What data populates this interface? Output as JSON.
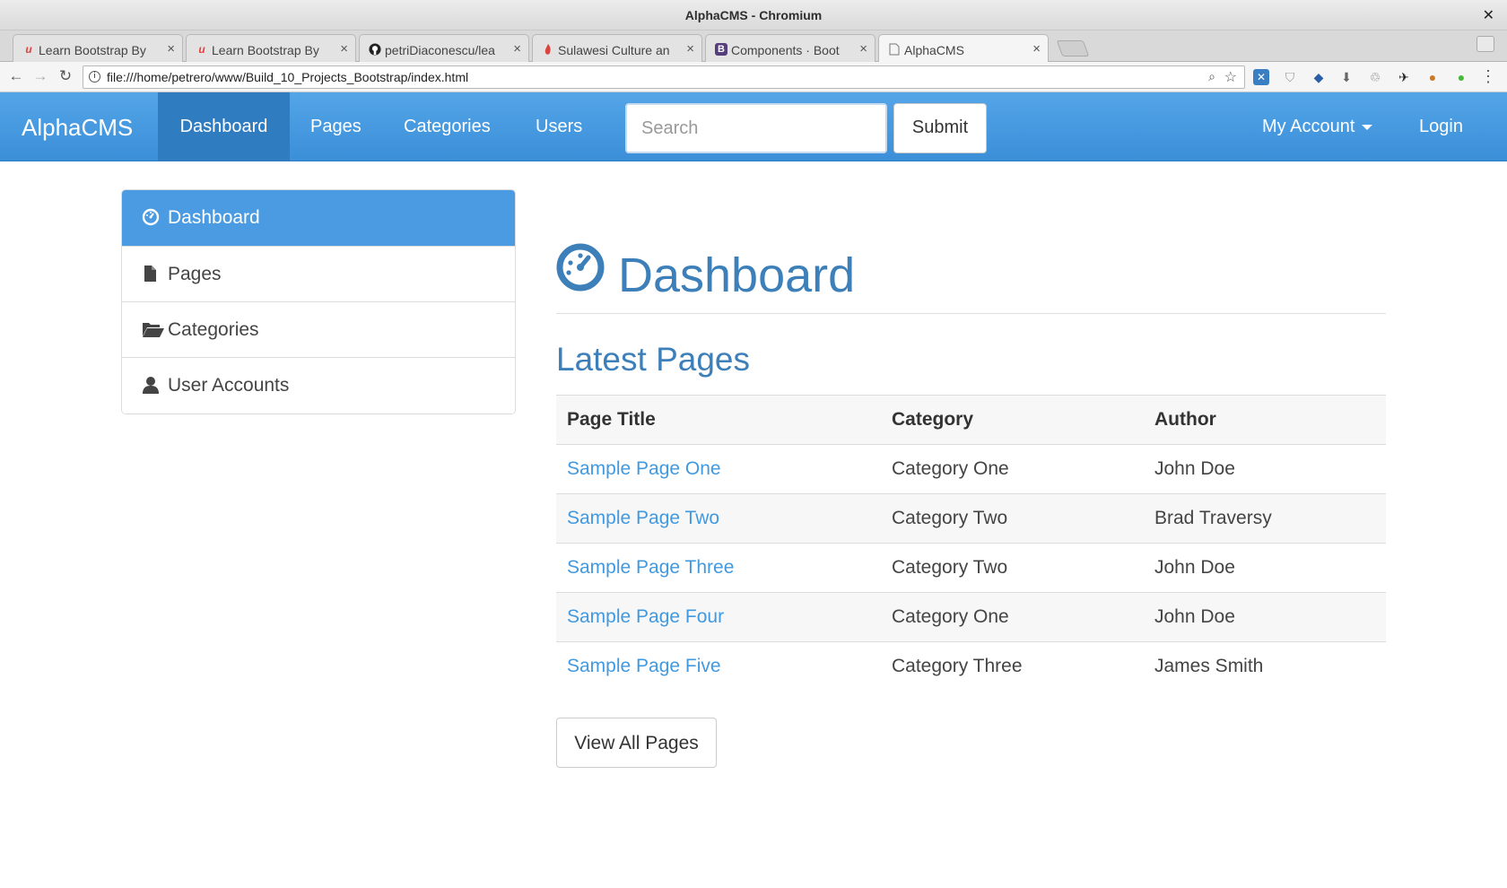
{
  "window": {
    "title": "AlphaCMS - Chromium",
    "close_glyph": "✕"
  },
  "tabs": [
    {
      "label": "Learn Bootstrap By",
      "favicon": "udemy-icon",
      "color": "#e2403c"
    },
    {
      "label": "Learn Bootstrap By",
      "favicon": "udemy-icon",
      "color": "#e2403c"
    },
    {
      "label": "petriDiaconescu/lea",
      "favicon": "github-icon",
      "color": "#222222"
    },
    {
      "label": "Sulawesi Culture an",
      "favicon": "flame-icon",
      "color": "#d9443c"
    },
    {
      "label": "Components · Boot",
      "favicon": "bootstrap-icon",
      "color": "#563d7c"
    },
    {
      "label": "AlphaCMS",
      "favicon": "page-icon",
      "color": "#777777"
    }
  ],
  "address_bar": {
    "url": "file:///home/petrero/www/Build_10_Projects_Bootstrap/index.html"
  },
  "navbar": {
    "brand": "AlphaCMS",
    "links": [
      "Dashboard",
      "Pages",
      "Categories",
      "Users"
    ],
    "search_placeholder": "Search",
    "submit_label": "Submit",
    "account_label": "My Account",
    "login_label": "Login",
    "accent": "#3b8fd8"
  },
  "sidebar": {
    "items": [
      {
        "label": "Dashboard",
        "icon": "dashboard-icon"
      },
      {
        "label": "Pages",
        "icon": "file-icon"
      },
      {
        "label": "Categories",
        "icon": "folder-open-icon"
      },
      {
        "label": "User Accounts",
        "icon": "user-icon"
      }
    ]
  },
  "main": {
    "title": "Dashboard",
    "section_title": "Latest Pages",
    "table": {
      "headers": [
        "Page Title",
        "Category",
        "Author"
      ],
      "rows": [
        [
          "Sample Page One",
          "Category One",
          "John Doe"
        ],
        [
          "Sample Page Two",
          "Category Two",
          "Brad Traversy"
        ],
        [
          "Sample Page Three",
          "Category Two",
          "John Doe"
        ],
        [
          "Sample Page Four",
          "Category One",
          "John Doe"
        ],
        [
          "Sample Page Five",
          "Category Three",
          "James Smith"
        ]
      ]
    },
    "view_all_label": "View All Pages"
  },
  "colors": {
    "title_blue": "#3d7fb9",
    "link_blue": "#4199e0",
    "active_sidebar": "#4a9be2"
  }
}
